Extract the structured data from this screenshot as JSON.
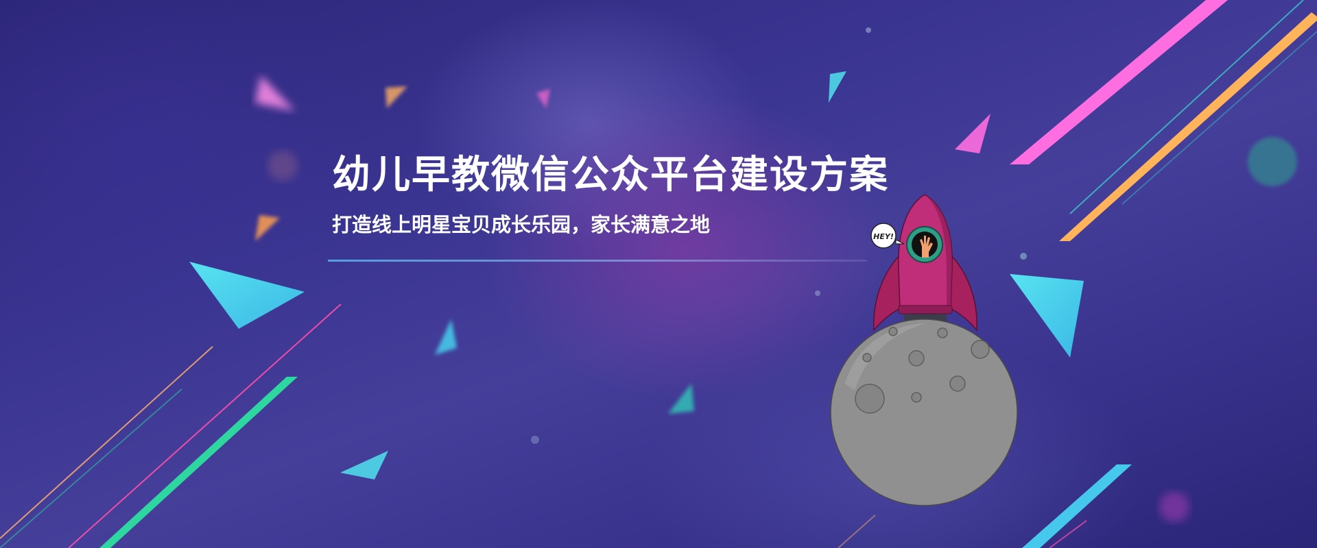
{
  "banner": {
    "title": "幼儿早教微信公众平台建设方案",
    "subtitle": "打造线上明星宝贝成长乐园，家长满意之地",
    "speech_bubble_text": "HEY!"
  },
  "colors": {
    "background": "#3b3592",
    "rocket": "#c02d78",
    "moon": "#909090",
    "accent_pink": "#ff6ee0",
    "accent_orange": "#ffb35a",
    "accent_cyan": "#4fd8ea",
    "accent_teal": "#2ed6a0"
  },
  "icons": {
    "rocket": "rocket-illustration",
    "moon": "moon-illustration",
    "bubble": "speech-bubble-icon"
  }
}
